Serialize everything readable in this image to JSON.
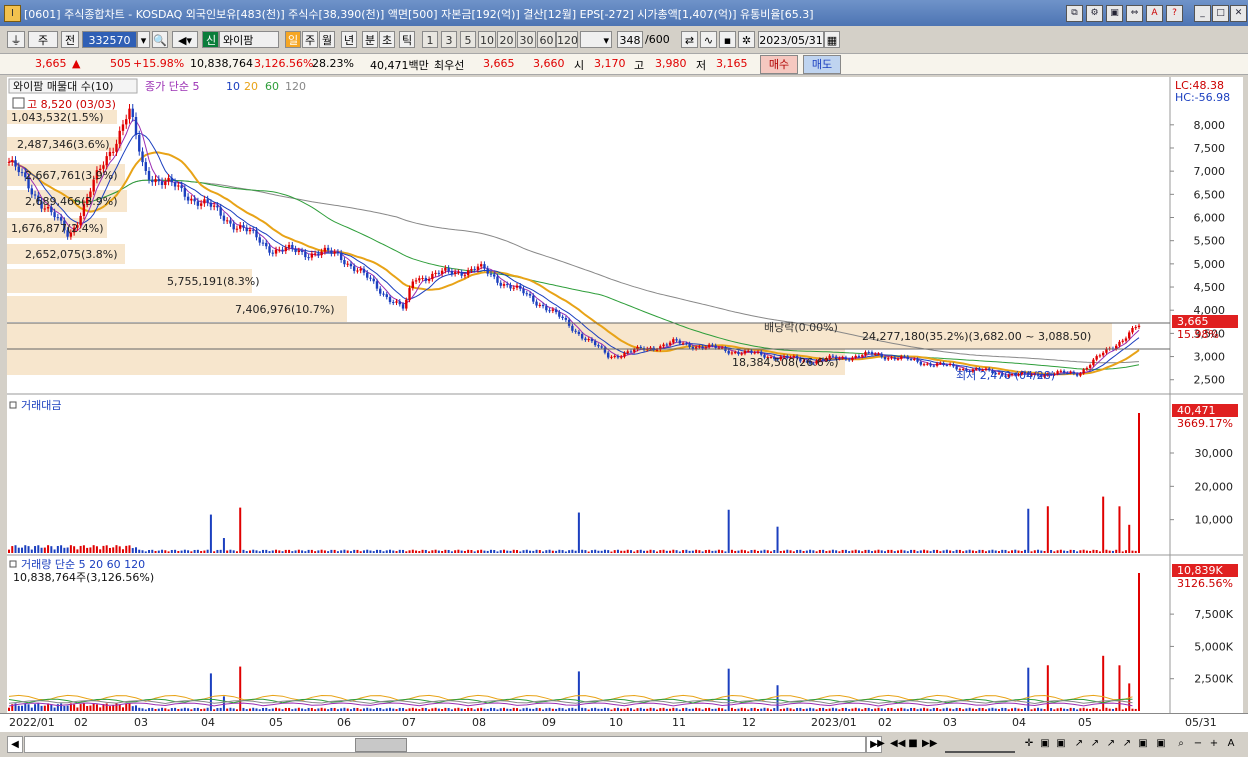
{
  "window": {
    "title": "[0601] 주식종합차트 - KOSDAQ 외국인보유[483(천)] 주식수[38,390(천)] 액면[500] 자본금[192(억)] 결산[12월] EPS[-272] 시가총액[1,407(억)] 유통비율[65.3]",
    "app_icon": "chart-app-icon"
  },
  "toolbar": {
    "stock_type": "주",
    "prev_label": "전",
    "code": "332570",
    "credit_label": "신",
    "stock_name": "와이팜",
    "period_tabs": [
      "일",
      "주",
      "월",
      "년",
      "분",
      "초",
      "틱"
    ],
    "active_tab": "일",
    "intervals": [
      "1",
      "3",
      "5",
      "10",
      "20",
      "30",
      "60",
      "120"
    ],
    "count": "348",
    "count_total": "/600",
    "date": "2023/05/31"
  },
  "quote": {
    "price": "3,665",
    "change_arrow": "▲",
    "change": "505",
    "change_pct": "+15.98%",
    "volume": "10,838,764",
    "volume_pct": "3,126.56%",
    "turnover": "28.23%",
    "amount": "40,471백만",
    "best_label": "최우선",
    "best_ask": "3,665",
    "best_bid": "3,660",
    "open_label": "시",
    "open": "3,170",
    "high_label": "고",
    "high": "3,980",
    "low_label": "저",
    "low": "3,165",
    "buy_label": "매수",
    "sell_label": "매도"
  },
  "price_panel": {
    "legend_title": "와이팜 매물대 수(10)",
    "ma_legend": [
      "종가 단순 5",
      "10",
      "20",
      "60",
      "120"
    ],
    "ma_colors": [
      "#9b2fb4",
      "#1b3fbf",
      "#e8a317",
      "#2e9e3a",
      "#888888"
    ],
    "high_marker": "고 8,520 (03/03)",
    "low_marker": "최저 2,470 (04/28)",
    "dividend_label": "배당락(0.00%)",
    "volume_profile": [
      "1,043,532(1.5%)",
      "2,487,346(3.6%)",
      "2,667,761(3.9%)",
      "2,689,466(3.9%)",
      "1,676,877(2.4%)",
      "2,652,075(3.8%)",
      "5,755,191(8.3%)",
      "7,406,976(10.7%)",
      "24,277,180(35.2%)(3,682.00 ~ 3,088.50)",
      "18,384,508(26.6%)"
    ],
    "lc": "LC:48.38",
    "hc": "HC:-56.98",
    "current_price": "3,665",
    "current_pct": "15.98%",
    "y_ticks": [
      "8,000",
      "7,500",
      "7,000",
      "6,500",
      "6,000",
      "5,500",
      "5,000",
      "4,500",
      "4,000",
      "3,500",
      "3,000",
      "2,500"
    ]
  },
  "amount_panel": {
    "title": "거래대금",
    "last_value": "40,471",
    "last_pct": "3669.17%",
    "y_ticks": [
      "30,000",
      "20,000",
      "10,000"
    ]
  },
  "volume_panel": {
    "title": "거래량 단순 5 20 60 120",
    "subtitle": "10,838,764주(3,126.56%)",
    "last_value": "10,839K",
    "last_pct": "3126.56%",
    "y_ticks": [
      "7,500K",
      "5,000K",
      "2,500K"
    ]
  },
  "x_axis": {
    "labels": [
      "2022/01",
      "02",
      "03",
      "04",
      "05",
      "06",
      "07",
      "08",
      "09",
      "10",
      "11",
      "12",
      "2023/01",
      "02",
      "03",
      "04",
      "05",
      "05/31"
    ]
  },
  "chart_data": {
    "type": "candlestick",
    "approximate_close_path": [
      {
        "x": "2022/01",
        "y": 7200
      },
      {
        "x": "02",
        "y": 5600
      },
      {
        "x": "03",
        "y": 8300
      },
      {
        "x": "03",
        "y": 7000
      },
      {
        "x": "04",
        "y": 6300
      },
      {
        "x": "05",
        "y": 5300
      },
      {
        "x": "06",
        "y": 5200
      },
      {
        "x": "07",
        "y": 4000
      },
      {
        "x": "07",
        "y": 4700
      },
      {
        "x": "08",
        "y": 4900
      },
      {
        "x": "09",
        "y": 4100
      },
      {
        "x": "10",
        "y": 3000
      },
      {
        "x": "11",
        "y": 3300
      },
      {
        "x": "12",
        "y": 3100
      },
      {
        "x": "2023/01",
        "y": 2900
      },
      {
        "x": "02",
        "y": 3050
      },
      {
        "x": "03",
        "y": 2800
      },
      {
        "x": "04",
        "y": 2600
      },
      {
        "x": "05",
        "y": 2650
      },
      {
        "x": "05/31",
        "y": 3665
      }
    ],
    "ylim": [
      2300,
      8600
    ]
  }
}
